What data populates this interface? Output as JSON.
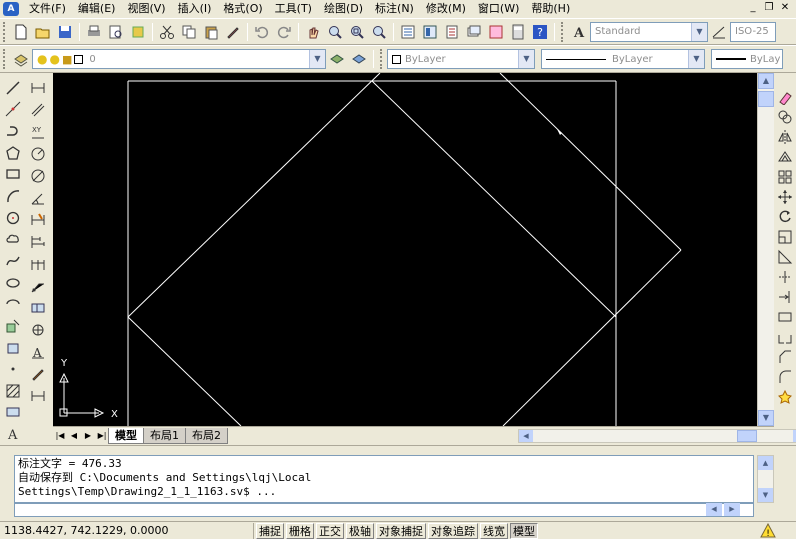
{
  "menubar": {
    "app_icon": "autocad-icon",
    "items": [
      "文件(F)",
      "编辑(E)",
      "视图(V)",
      "插入(I)",
      "格式(O)",
      "工具(T)",
      "绘图(D)",
      "标注(N)",
      "修改(M)",
      "窗口(W)",
      "帮助(H)"
    ]
  },
  "toolbar1": {
    "text_style": "Standard",
    "dim_style": "ISO-25"
  },
  "toolbar2": {
    "layer_name": "0",
    "color": "ByLayer",
    "linetype": "ByLayer",
    "lineweight": "ByLay"
  },
  "layout_tabs": [
    "模型",
    "布局1",
    "布局2"
  ],
  "active_tab": "模型",
  "ucs": {
    "x_label": "X",
    "y_label": "Y"
  },
  "command_lines": [
    "标注文字 = 476.33",
    "自动保存到 C:\\Documents and Settings\\lqj\\Local",
    "Settings\\Temp\\Drawing2_1_1_1163.sv$ ..."
  ],
  "status": {
    "coords": "1138.4427, 742.1229, 0.0000",
    "buttons": [
      {
        "label": "捕捉",
        "on": false
      },
      {
        "label": "栅格",
        "on": false
      },
      {
        "label": "正交",
        "on": false
      },
      {
        "label": "极轴",
        "on": false
      },
      {
        "label": "对象捕捉",
        "on": false
      },
      {
        "label": "对象追踪",
        "on": false
      },
      {
        "label": "线宽",
        "on": false
      },
      {
        "label": "模型",
        "on": true
      }
    ]
  },
  "colors": {
    "canvas_bg": "#000000",
    "drawing_line": "#ffffff",
    "chrome": "#ece9d8"
  }
}
